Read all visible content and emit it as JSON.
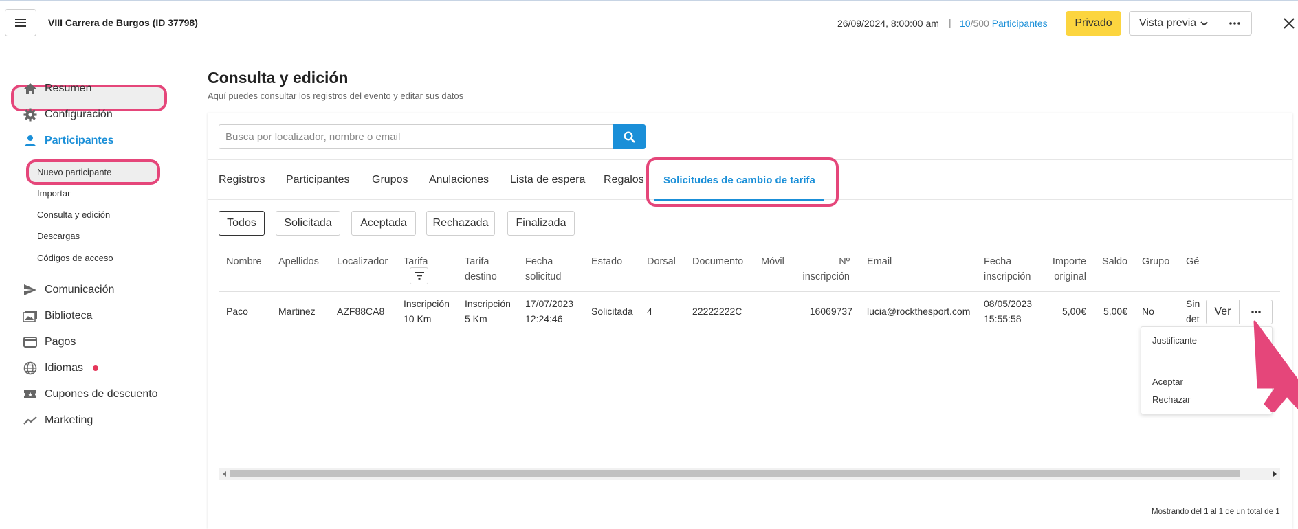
{
  "header": {
    "event_title": "VIII Carrera de Burgos (ID 37798)",
    "date": "26/09/2024, 8:00:00 am",
    "separator": "|",
    "count_current": "10",
    "count_total": "/500",
    "count_label": "Participantes",
    "private_label": "Privado",
    "preview_label": "Vista previa"
  },
  "sidebar": {
    "items": [
      {
        "label": "Resumen",
        "icon": "home-icon"
      },
      {
        "label": "Configuración",
        "icon": "gear-icon"
      },
      {
        "label": "Participantes",
        "icon": "person-icon"
      },
      {
        "label": "Comunicación",
        "icon": "send-icon"
      },
      {
        "label": "Biblioteca",
        "icon": "images-icon"
      },
      {
        "label": "Pagos",
        "icon": "credit-card-icon"
      },
      {
        "label": "Idiomas",
        "icon": "globe-icon"
      },
      {
        "label": "Cupones de descuento",
        "icon": "ticket-icon"
      },
      {
        "label": "Marketing",
        "icon": "trend-icon"
      }
    ],
    "subitems": [
      "Nuevo participante",
      "Importar",
      "Consulta y edición",
      "Descargas",
      "Códigos de acceso"
    ]
  },
  "page": {
    "title": "Consulta y edición",
    "subtitle": "Aquí puedes consultar los registros del evento y editar sus datos"
  },
  "search": {
    "placeholder": "Busca por localizador, nombre o email"
  },
  "tabs": [
    "Registros",
    "Participantes",
    "Grupos",
    "Anulaciones",
    "Lista de espera",
    "Regalos",
    "Solicitudes de cambio de tarifa"
  ],
  "filters": [
    "Todos",
    "Solicitada",
    "Aceptada",
    "Rechazada",
    "Finalizada"
  ],
  "table": {
    "headers": {
      "nombre": "Nombre",
      "apellidos": "Apellidos",
      "localizador": "Localizador",
      "tarifa": "Tarifa",
      "tarifa_destino_1": "Tarifa",
      "tarifa_destino_2": "destino",
      "fecha_solicitud_1": "Fecha",
      "fecha_solicitud_2": "solicitud",
      "estado": "Estado",
      "dorsal": "Dorsal",
      "documento": "Documento",
      "movil": "Móvil",
      "n_inscripcion_1": "Nº",
      "n_inscripcion_2": "inscripción",
      "email": "Email",
      "fecha_inscripcion_1": "Fecha",
      "fecha_inscripcion_2": "inscripción",
      "importe_1": "Importe",
      "importe_2": "original",
      "saldo": "Saldo",
      "grupo": "Grupo",
      "genero": "Gé"
    },
    "row": {
      "nombre": "Paco",
      "apellidos": "Martinez",
      "localizador": "AZF88CA8",
      "tarifa_1": "Inscripción",
      "tarifa_2": "10 Km",
      "tarifa_destino_1": "Inscripción",
      "tarifa_destino_2": "5 Km",
      "fecha_solicitud_1": "17/07/2023",
      "fecha_solicitud_2": "12:24:46",
      "estado": "Solicitada",
      "dorsal": "4",
      "documento": "22222222C",
      "movil": "",
      "n_inscripcion": "16069737",
      "email": "lucia@rockthesport.com",
      "fecha_inscripcion_1": "08/05/2023",
      "fecha_inscripcion_2": "15:55:58",
      "importe": "5,00€",
      "saldo": "5,00€",
      "grupo": "No",
      "genero_1": "Sin",
      "genero_2": "det"
    },
    "view_label": "Ver"
  },
  "row_menu": {
    "items": [
      "Justificante",
      "Aceptar",
      "Rechazar"
    ]
  },
  "footer": {
    "count_text": "Mostrando del 1 al 1 de un total de 1"
  },
  "colors": {
    "accent": "#1a8fd8",
    "highlight": "#e5467a",
    "private": "#fcd53f"
  }
}
